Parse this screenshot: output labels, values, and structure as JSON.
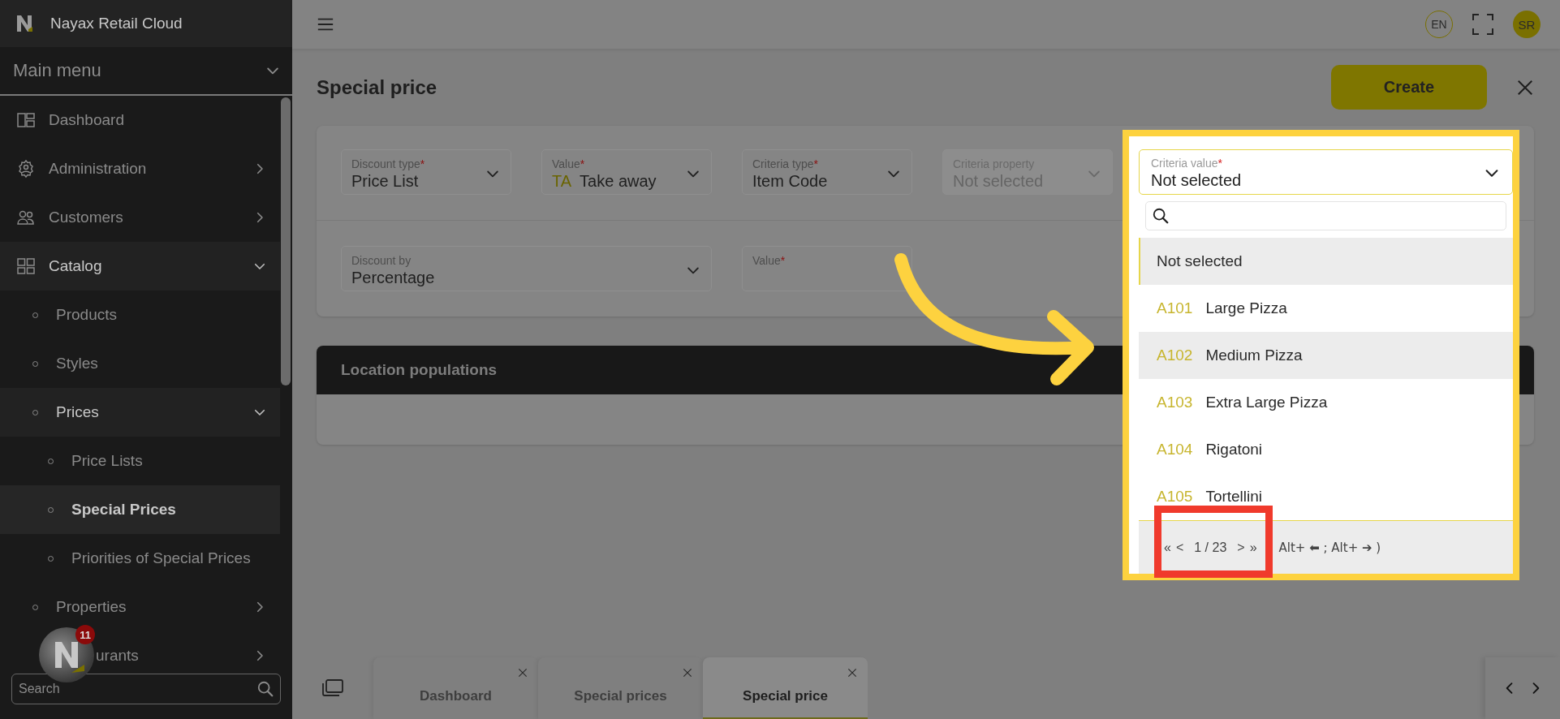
{
  "app": {
    "brand": "Nayax Retail Cloud"
  },
  "sidebar": {
    "menu_title": "Main menu",
    "menu_expanded": true,
    "items": [
      {
        "label": "Dashboard",
        "kind": "dashboard",
        "selected": false
      },
      {
        "label": "Administration",
        "kind": "gear",
        "selected": false,
        "expanded": false
      },
      {
        "label": "Customers",
        "kind": "people",
        "selected": false,
        "expanded": false
      },
      {
        "label": "Catalog",
        "kind": "grid",
        "selected": false,
        "expanded": true,
        "children": [
          {
            "label": "Products",
            "selected": false
          },
          {
            "label": "Styles",
            "selected": false
          },
          {
            "label": "Prices",
            "selected": false,
            "expanded": true,
            "children": [
              {
                "label": "Price Lists",
                "selected": false
              },
              {
                "label": "Special Prices",
                "selected": true
              },
              {
                "label": "Priorities of Special Prices",
                "selected": false
              }
            ]
          },
          {
            "label": "Properties",
            "selected": false,
            "expanded": false
          },
          {
            "label": "urants",
            "selected": false,
            "expanded": false
          }
        ]
      }
    ],
    "notification_count": "11",
    "search": {
      "placeholder": "Search"
    }
  },
  "topbar": {
    "language": "EN",
    "user_initials": "SR"
  },
  "page": {
    "title": "Special price",
    "create_button": "Create"
  },
  "form": {
    "criteria_fields": [
      {
        "label": "Discount type",
        "required_mark": "*",
        "value": "Price List",
        "disabled": false,
        "kind": "select"
      },
      {
        "label": "Value",
        "required_mark": "*",
        "code": "TA",
        "value": "Take away",
        "disabled": false,
        "kind": "select"
      },
      {
        "label": "Criteria type",
        "required_mark": "*",
        "value": "Item Code",
        "disabled": false,
        "kind": "select"
      },
      {
        "label": "Criteria property",
        "value": "Not selected",
        "disabled": true,
        "kind": "select"
      }
    ],
    "discount_fields": [
      {
        "label": "Discount by",
        "value": "Percentage",
        "disabled": false,
        "kind": "select"
      },
      {
        "label": "Value",
        "required_mark": "*",
        "disabled": false,
        "kind": "input"
      }
    ]
  },
  "criteria_dropdown": {
    "label": "Criteria value",
    "required_mark": "*",
    "value": "Not selected",
    "options": [
      {
        "label": "Not selected",
        "selected": true,
        "hovered": false
      },
      {
        "code": "A101",
        "label": "Large Pizza",
        "selected": false,
        "hovered": false
      },
      {
        "code": "A102",
        "label": "Medium Pizza",
        "selected": false,
        "hovered": true
      },
      {
        "code": "A103",
        "label": "Extra Large Pizza",
        "selected": false,
        "hovered": false
      },
      {
        "code": "A104",
        "label": "Rigatoni",
        "selected": false,
        "hovered": false
      },
      {
        "code": "A105",
        "label": "Tortellini",
        "selected": false,
        "hovered": false
      }
    ],
    "pager": {
      "first": "«",
      "previous": "<",
      "page": "1 / 23",
      "next": ">",
      "last": "»",
      "hint": "Alt+ ⬅ ; Alt+ ➔ )"
    }
  },
  "sections": [
    {
      "title": "Location populations"
    }
  ],
  "tabs": [
    {
      "label": "Dashboard",
      "selected": false
    },
    {
      "label": "Special prices",
      "selected": false
    },
    {
      "label": "Special price",
      "selected": true
    }
  ]
}
